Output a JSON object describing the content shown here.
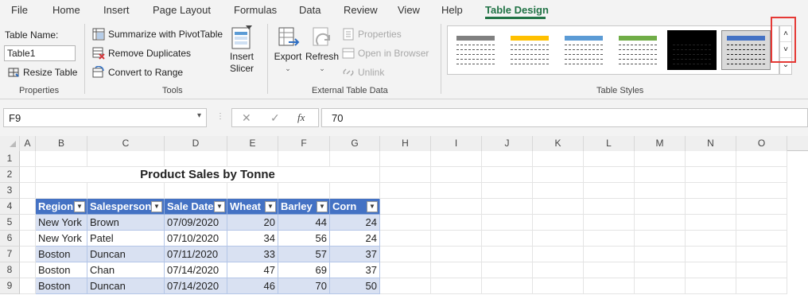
{
  "tabs": [
    "File",
    "Home",
    "Insert",
    "Page Layout",
    "Formulas",
    "Data",
    "Review",
    "View",
    "Help",
    "Table Design"
  ],
  "properties": {
    "table_name_label": "Table Name:",
    "table_name_value": "Table1",
    "resize": "Resize Table",
    "group": "Properties"
  },
  "tools": {
    "summarize": "Summarize with PivotTable",
    "remove_dup": "Remove Duplicates",
    "convert": "Convert to Range",
    "slicer": "Insert\nSlicer",
    "slicer_l1": "Insert",
    "slicer_l2": "Slicer",
    "group": "Tools"
  },
  "external": {
    "export": "Export",
    "refresh": "Refresh",
    "properties": "Properties",
    "open_browser": "Open in Browser",
    "unlink": "Unlink",
    "group": "External Table Data"
  },
  "styles": {
    "group": "Table Styles",
    "tiles": [
      "#808080",
      "#ffc000",
      "#5b9bd5",
      "#70ad47",
      "#000000",
      "#4472c4"
    ]
  },
  "formula_bar": {
    "cell_ref": "F9",
    "value": "70"
  },
  "columns": [
    "A",
    "B",
    "C",
    "D",
    "E",
    "F",
    "G",
    "H",
    "I",
    "J",
    "K",
    "L",
    "M",
    "N",
    "O"
  ],
  "rows": [
    "1",
    "2",
    "3",
    "4",
    "5",
    "6",
    "7",
    "8",
    "9"
  ],
  "sheet": {
    "title": "Product Sales by Tonne",
    "headers": [
      "Region",
      "Salesperson",
      "Sale Date",
      "Wheat",
      "Barley",
      "Corn"
    ],
    "data": [
      [
        "New York",
        "Brown",
        "07/09/2020",
        "20",
        "44",
        "24"
      ],
      [
        "New York",
        "Patel",
        "07/10/2020",
        "34",
        "56",
        "24"
      ],
      [
        "Boston",
        "Duncan",
        "07/11/2020",
        "33",
        "57",
        "37"
      ],
      [
        "Boston",
        "Chan",
        "07/14/2020",
        "47",
        "69",
        "37"
      ],
      [
        "Boston",
        "Duncan",
        "07/14/2020",
        "46",
        "70",
        "50"
      ]
    ]
  }
}
